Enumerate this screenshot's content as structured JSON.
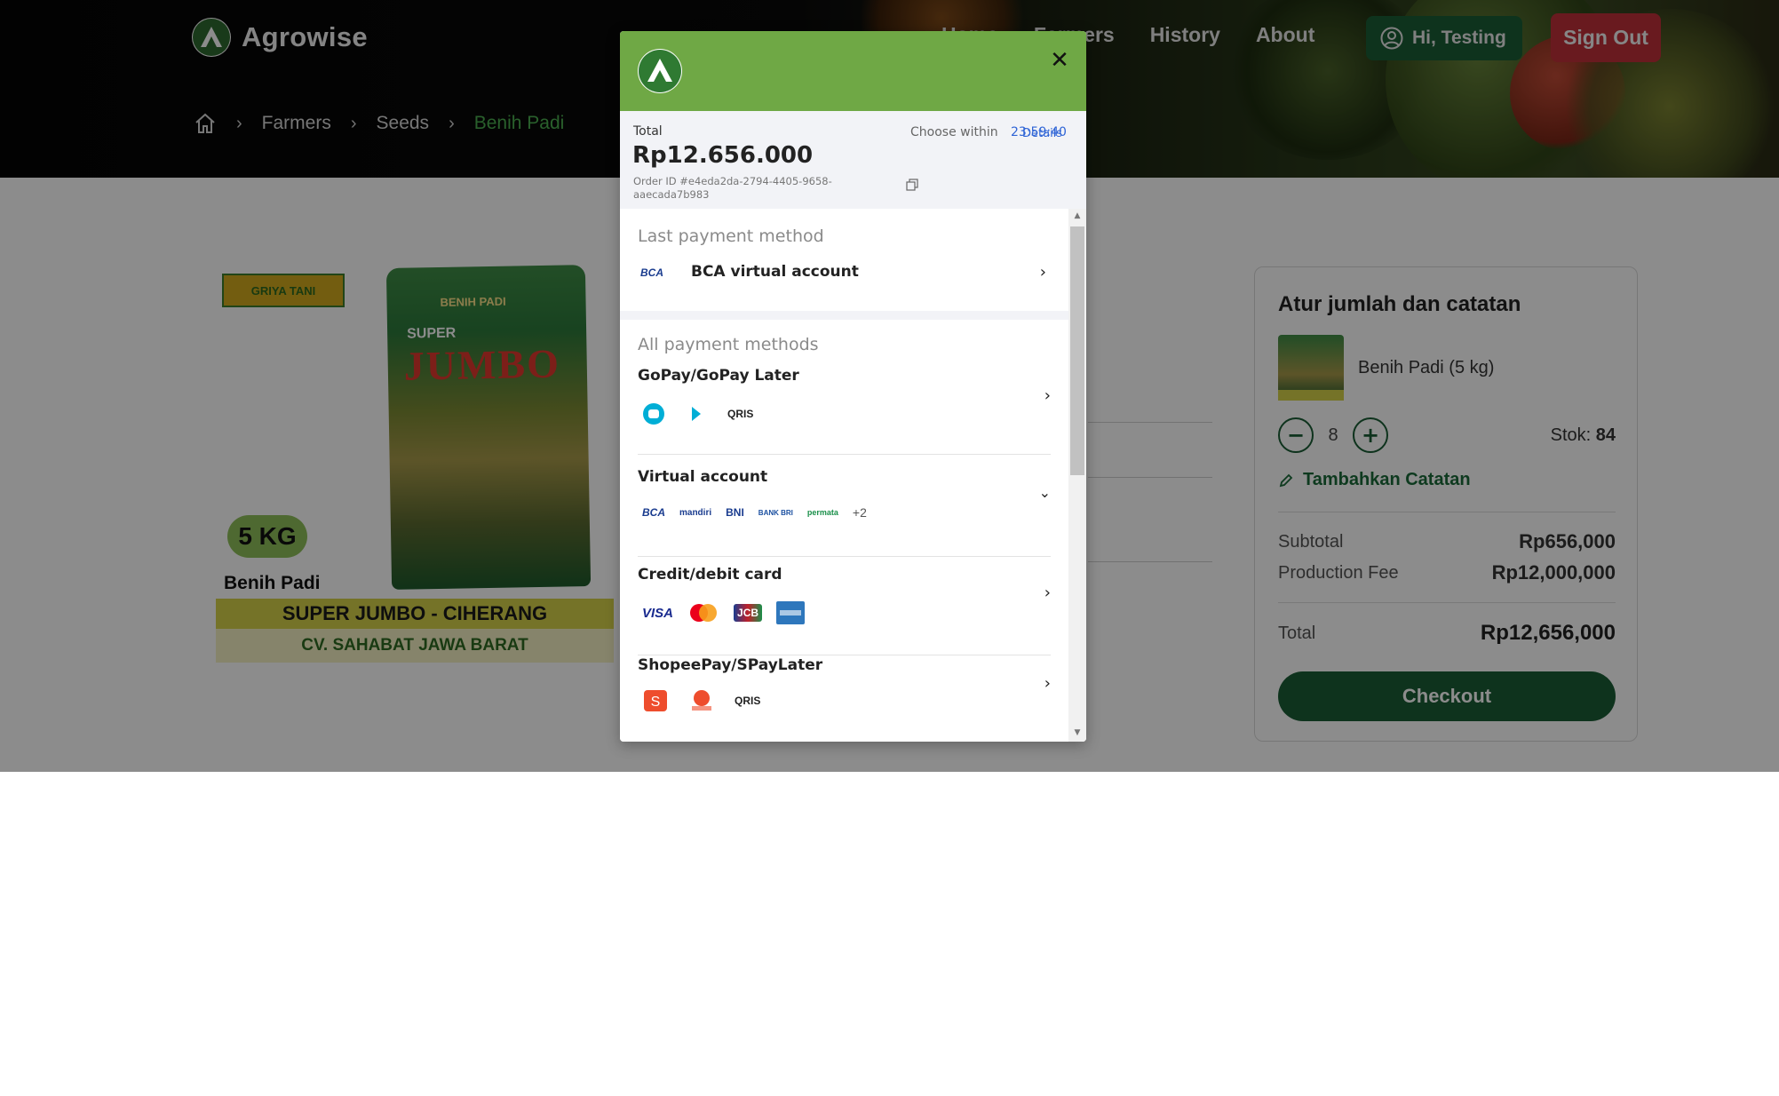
{
  "app": {
    "name": "Agrowise"
  },
  "nav": {
    "items": [
      "Home",
      "Farmers",
      "History",
      "About"
    ],
    "user_greeting": "Hi, Testing",
    "sign_out": "Sign Out"
  },
  "breadcrumb": {
    "items": [
      "Farmers",
      "Seeds",
      "Benih Padi"
    ]
  },
  "product": {
    "image_texts": {
      "brand_badge": "GRIYA TANI",
      "sack_header": "BENIH PADI",
      "sack_super": "SUPER",
      "sack_jumbo": "JUMBO",
      "weight_badge": "5 KG",
      "small_name": "Benih Padi",
      "banner_title": "SUPER JUMBO - CIHERANG",
      "banner_sub": "CV. SAHABAT JAWA BARAT"
    }
  },
  "order_card": {
    "title": "Atur jumlah dan catatan",
    "product_label": "Benih Padi (5 kg)",
    "quantity": "8",
    "stock_label": "Stok:",
    "stock_value": "84",
    "add_note": "Tambahkan Catatan",
    "subtotal_label": "Subtotal",
    "subtotal_value": "Rp656,000",
    "fee_label": "Production Fee",
    "fee_value": "Rp12,000,000",
    "total_label": "Total",
    "total_value": "Rp12,656,000",
    "checkout": "Checkout"
  },
  "payment_modal": {
    "total_label": "Total",
    "total_value": "Rp12.656.000",
    "order_id": "Order ID #e4eda2da-2794-4405-9658-aaecada7b983",
    "choose_within": "Choose within",
    "timer": "23:59:40",
    "details": "Details",
    "last_method_title": "Last payment method",
    "last_method": "BCA virtual account",
    "all_methods_title": "All payment methods",
    "methods": [
      {
        "name": "GoPay/GoPay Later",
        "icons": [
          "gopay-icon",
          "gopay-later-icon",
          "qris-icon"
        ]
      },
      {
        "name": "Virtual account",
        "icons": [
          "BCA",
          "mandiri",
          "BNI",
          "BANK BRI",
          "permata"
        ],
        "more": "+2"
      },
      {
        "name": "Credit/debit card",
        "icons": [
          "VISA",
          "mastercard-icon",
          "JCB",
          "amex-icon"
        ]
      },
      {
        "name": "ShopeePay/SPayLater",
        "icons": [
          "shopeepay-icon",
          "spaylater-icon",
          "qris-icon"
        ]
      }
    ]
  },
  "colors": {
    "brand_green": "#1b5e35",
    "modal_header": "#6fa845",
    "sign_out_red": "#c0303a",
    "link_blue": "#2f64d6"
  }
}
